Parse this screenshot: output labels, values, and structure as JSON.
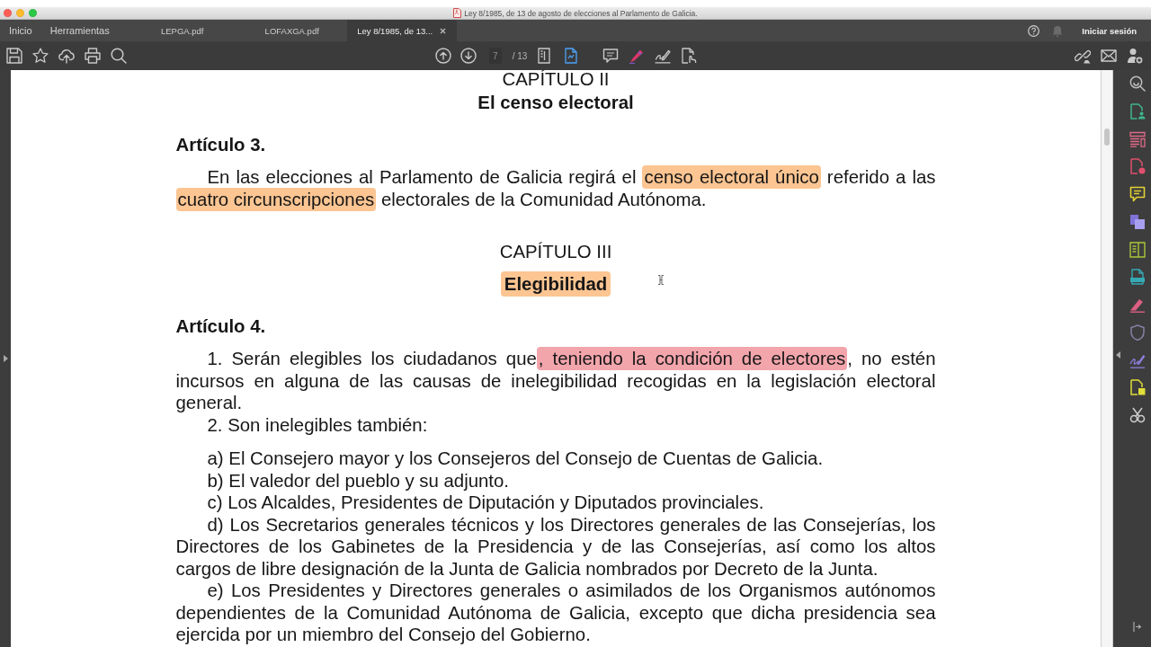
{
  "window": {
    "title": "Ley 8/1985, de 13 de agosto de elecciones al Parlamento de Galicia."
  },
  "nav": [
    {
      "label": "Inicio"
    },
    {
      "label": "Herramientas"
    }
  ],
  "tabs": [
    {
      "label": "LEPGA.pdf",
      "selected": false
    },
    {
      "label": "LOFAXGA.pdf",
      "selected": false
    },
    {
      "label": "Ley 8/1985, de 13...",
      "selected": true
    }
  ],
  "account": {
    "sign_in": "Iniciar sesión"
  },
  "toolbar": {
    "page": "7",
    "page_count": "/ 13",
    "view_buttons": [
      {
        "selected": false
      },
      {
        "selected": true
      }
    ]
  },
  "document": {
    "blocks": [
      {
        "kind": "chapter",
        "text": "CAPÍTULO II"
      },
      {
        "kind": "title",
        "text": "El censo electoral"
      },
      {
        "kind": "article",
        "text": "Artículo 3."
      },
      {
        "kind": "paragraph",
        "segments": [
          {
            "text": "En las elecciones al Parlamento de Galicia regirá el "
          },
          {
            "text": "censo electoral único",
            "color": "#fcc592"
          },
          {
            "text": " referido a las "
          },
          {
            "text": "cuatro circunscripciones",
            "color": "#fcc592"
          },
          {
            "text": " electorales de la Comunidad Autónoma."
          }
        ]
      },
      {
        "kind": "chapter",
        "text": "CAPÍTULO III"
      },
      {
        "kind": "title",
        "text": "Elegibilidad",
        "color": "#fcc592"
      },
      {
        "kind": "article",
        "text": "Artículo 4."
      },
      {
        "kind": "paragraph",
        "segments": [
          {
            "text": "1. Serán elegibles los ciudadanos que"
          },
          {
            "text": ", teniendo la condición de electores",
            "color": "#f3a5ac"
          },
          {
            "text": ", no estén incursos en alguna de las causas de inelegibilidad recogidas en la legislación electoral general."
          }
        ]
      },
      {
        "kind": "paragraph",
        "text": "2. Son inelegibles también:"
      },
      {
        "kind": "item",
        "text": "a) El Consejero mayor y los Consejeros del Consejo de Cuentas de Galicia."
      },
      {
        "kind": "item",
        "text": "b) El valedor del pueblo y su adjunto."
      },
      {
        "kind": "item",
        "text": "c) Los Alcaldes, Presidentes de Diputación y Diputados provinciales."
      },
      {
        "kind": "item",
        "text": "d) Los Secretarios generales técnicos y los Directores generales de las Consejerías, los Directores de los Gabinetes de la Presidencia y de las Consejerías, así como los altos cargos de libre designación de la Junta de Galicia nombrados por Decreto de la Junta."
      },
      {
        "kind": "item",
        "text": "e) Los Presidentes y Directores generales o asimilados de los Organismos autónomos dependientes de la Comunidad Autónoma de Galicia, excepto que dicha presidencia sea ejercida por un miembro del Consejo del Gobierno."
      }
    ]
  }
}
